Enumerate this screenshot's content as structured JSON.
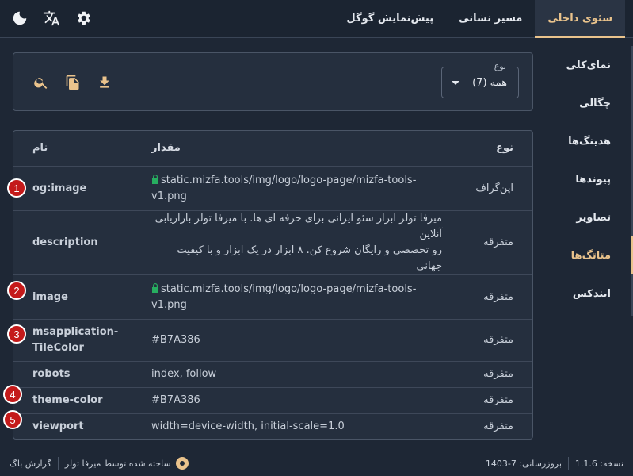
{
  "tabs": [
    {
      "label": "سئوی داخلی",
      "active": true
    },
    {
      "label": "مسیر نشانی",
      "active": false
    },
    {
      "label": "پیش‌نمایش گوگل",
      "active": false
    }
  ],
  "icons": {
    "theme": "moon-icon",
    "translate": "translate-icon",
    "settings": "gear-icon",
    "search": "search-icon",
    "copy": "copy-icon",
    "download": "download-icon"
  },
  "nav": [
    {
      "label": "نمای‌کلی",
      "active": false
    },
    {
      "label": "چگالی",
      "active": false
    },
    {
      "label": "هدینگ‌ها",
      "active": false
    },
    {
      "label": "پیوندها",
      "active": false
    },
    {
      "label": "تصاویر",
      "active": false
    },
    {
      "label": "متاتگ‌ها",
      "active": true
    },
    {
      "label": "ایندکس",
      "active": false
    }
  ],
  "filter": {
    "legend": "نوع",
    "value": "همه (7)"
  },
  "table": {
    "headers": {
      "name": "نام",
      "value": "مقدار",
      "type": "نوع"
    },
    "rows": [
      {
        "name": "og:image",
        "value": "static.mizfa.tools/img/logo/logo-page/mizfa-tools-v1.png",
        "type": "اپن‌گراف"
      },
      {
        "name": "description",
        "value_line1": "میزفا تولز ابزار سئو ایرانی برای حرفه ای ها. با میزفا تولز بازاریابی آنلاین",
        "value_line2": "رو تخصصی و رایگان شروع کن. ۸ ابزار در یک ابزار و با کیفیت جهانی",
        "type": "متفرقه"
      },
      {
        "name": "image",
        "value": "static.mizfa.tools/img/logo/logo-page/mizfa-tools-v1.png",
        "type": "متفرقه"
      },
      {
        "name_line1": "msapplication-",
        "name_line2": "TileColor",
        "value": "#B7A386",
        "type": "متفرقه"
      },
      {
        "name": "robots",
        "value": "index, follow",
        "type": "متفرقه"
      },
      {
        "name": "theme-color",
        "value": "#B7A386",
        "type": "متفرقه"
      },
      {
        "name": "viewport",
        "value": "width=device-width, initial-scale=1.0",
        "type": "متفرقه"
      }
    ]
  },
  "badges": [
    "1",
    "2",
    "3",
    "4",
    "5"
  ],
  "footer": {
    "made_by": "ساخته شده توسط میزفا تولز",
    "bug_report": "گزارش باگ",
    "version": "نسخه: 1.1.6",
    "updated": "بروزرسانی: 7-1403"
  },
  "colors": {
    "accent": "#eac38c",
    "secure": "#27ae60",
    "badge": "#c41a1a",
    "background": "#1e2735"
  }
}
